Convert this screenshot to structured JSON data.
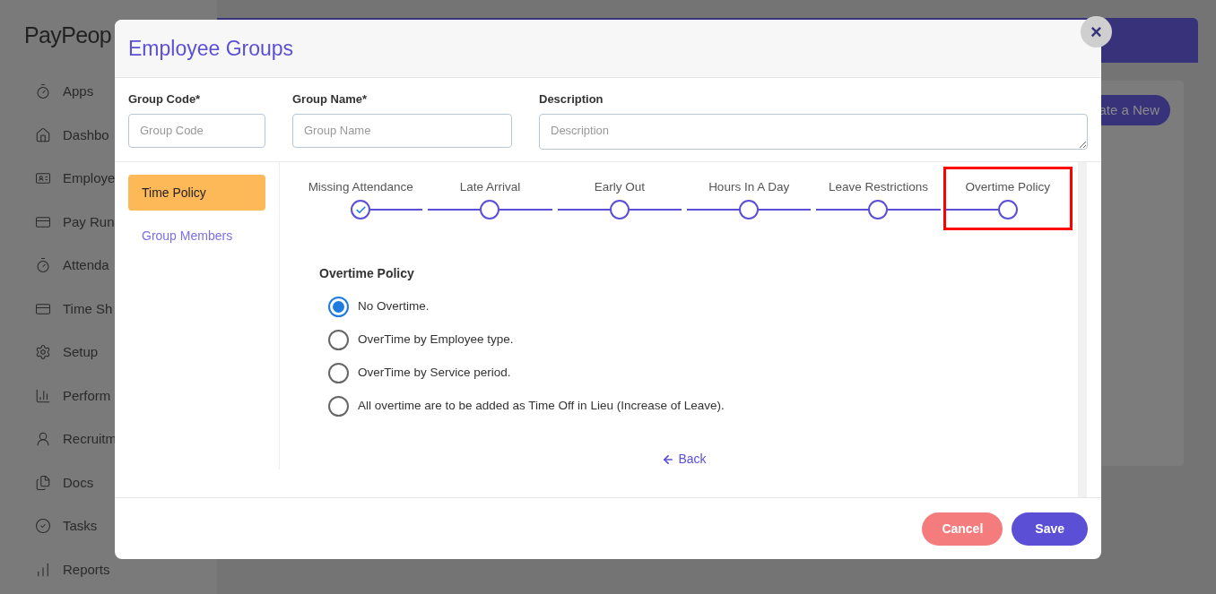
{
  "background": {
    "logo": "PayPeop",
    "nav_items": [
      {
        "label": "Apps",
        "kind": "timer"
      },
      {
        "label": "Dashbo",
        "kind": "home"
      },
      {
        "label": "Employe",
        "kind": "id"
      },
      {
        "label": "Pay Run",
        "kind": "card"
      },
      {
        "label": "Attenda",
        "kind": "timer"
      },
      {
        "label": "Time Sh",
        "kind": "card"
      },
      {
        "label": "Setup",
        "kind": "gear"
      },
      {
        "label": "Perform",
        "kind": "chart"
      },
      {
        "label": "Recruitm",
        "kind": "person"
      },
      {
        "label": "Docs",
        "kind": "docs"
      },
      {
        "label": "Tasks",
        "kind": "check"
      },
      {
        "label": "Reports",
        "kind": "bars"
      }
    ],
    "create_button": "ate a New"
  },
  "modal": {
    "title": "Employee Groups",
    "close": "×",
    "fields": [
      {
        "label": "Group Code*",
        "placeholder": "Group Code",
        "kind": "input"
      },
      {
        "label": "Group Name*",
        "placeholder": "Group Name",
        "kind": "input"
      },
      {
        "label": "Description",
        "placeholder": "Description",
        "kind": "textarea"
      }
    ],
    "tabs": [
      {
        "label": "Time Policy",
        "selected": true
      },
      {
        "label": "Group Members",
        "selected": false
      }
    ],
    "steps": [
      {
        "label": "Missing Attendance",
        "completed": true,
        "highlighted": false
      },
      {
        "label": "Late Arrival",
        "completed": false,
        "highlighted": false
      },
      {
        "label": "Early Out",
        "completed": false,
        "highlighted": false
      },
      {
        "label": "Hours In A Day",
        "completed": false,
        "highlighted": false
      },
      {
        "label": "Leave Restrictions",
        "completed": false,
        "highlighted": false
      },
      {
        "label": "Overtime Policy",
        "completed": false,
        "highlighted": true
      }
    ],
    "section_title": "Overtime Policy",
    "options": [
      {
        "label": "No Overtime.",
        "selected": true
      },
      {
        "label": "OverTime by Employee type.",
        "selected": false
      },
      {
        "label": "OverTime by Service period.",
        "selected": false
      },
      {
        "label": "All overtime are to be added as Time Off in Lieu (Increase of Leave).",
        "selected": false
      }
    ],
    "back_link": "Back",
    "buttons": [
      {
        "label": "Cancel",
        "kind": "cancel"
      },
      {
        "label": "Save",
        "kind": "primary"
      }
    ]
  }
}
